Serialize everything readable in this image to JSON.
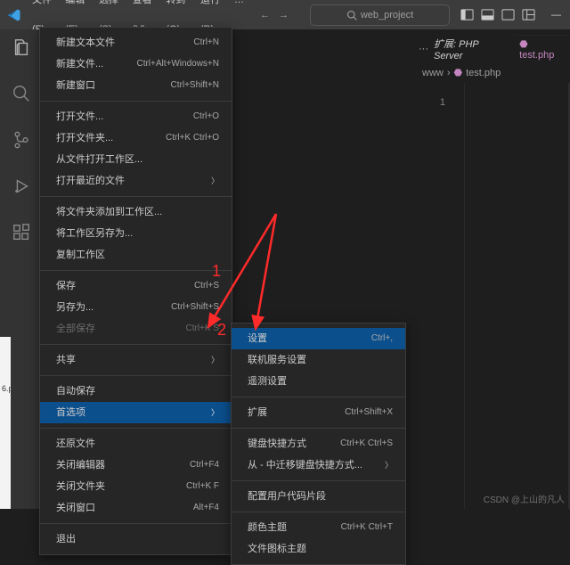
{
  "menubar": {
    "items": [
      "文件(F)",
      "编辑(E)",
      "选择(S)",
      "查看(V)",
      "转到(G)",
      "运行(R)",
      "…"
    ]
  },
  "search": {
    "placeholder": "web_project"
  },
  "editorRight": {
    "dots": "···",
    "extLabel": "扩展: PHP Server",
    "tab": "test.php",
    "breadcrumb": [
      "www",
      "test.php"
    ],
    "lineNumber": "1"
  },
  "fileMenu": [
    {
      "label": "新建文本文件",
      "kb": "Ctrl+N"
    },
    {
      "label": "新建文件...",
      "kb": "Ctrl+Alt+Windows+N"
    },
    {
      "label": "新建窗口",
      "kb": "Ctrl+Shift+N"
    },
    {
      "sep": true
    },
    {
      "label": "打开文件...",
      "kb": "Ctrl+O"
    },
    {
      "label": "打开文件夹...",
      "kb": "Ctrl+K Ctrl+O"
    },
    {
      "label": "从文件打开工作区..."
    },
    {
      "label": "打开最近的文件",
      "sub": true
    },
    {
      "sep": true
    },
    {
      "label": "将文件夹添加到工作区..."
    },
    {
      "label": "将工作区另存为..."
    },
    {
      "label": "复制工作区"
    },
    {
      "sep": true
    },
    {
      "label": "保存",
      "kb": "Ctrl+S"
    },
    {
      "label": "另存为...",
      "kb": "Ctrl+Shift+S"
    },
    {
      "label": "全部保存",
      "kb": "Ctrl+K S",
      "disabled": true
    },
    {
      "sep": true
    },
    {
      "label": "共享",
      "sub": true
    },
    {
      "sep": true
    },
    {
      "label": "自动保存"
    },
    {
      "label": "首选项",
      "sub": true,
      "hl": true
    },
    {
      "sep": true
    },
    {
      "label": "还原文件"
    },
    {
      "label": "关闭编辑器",
      "kb": "Ctrl+F4"
    },
    {
      "label": "关闭文件夹",
      "kb": "Ctrl+K F"
    },
    {
      "label": "关闭窗口",
      "kb": "Alt+F4"
    },
    {
      "sep": true
    },
    {
      "label": "退出"
    }
  ],
  "prefSubmenu": [
    {
      "label": "设置",
      "kb": "Ctrl+,",
      "hl": true
    },
    {
      "label": "联机服务设置"
    },
    {
      "label": "遥测设置"
    },
    {
      "sep": true
    },
    {
      "label": "扩展",
      "kb": "Ctrl+Shift+X"
    },
    {
      "sep": true
    },
    {
      "label": "键盘快捷方式",
      "kb": "Ctrl+K Ctrl+S"
    },
    {
      "label": "从 - 中迁移键盘快捷方式...",
      "sub": true
    },
    {
      "sep": true
    },
    {
      "label": "配置用户代码片段"
    },
    {
      "sep": true
    },
    {
      "label": "颜色主题",
      "kb": "Ctrl+K Ctrl+T"
    },
    {
      "label": "文件图标主题"
    }
  ],
  "annotations": {
    "one": "1",
    "two": "2"
  },
  "lightStrip": {
    "text": "6.p"
  },
  "watermark": "CSDN @上山的凡人"
}
